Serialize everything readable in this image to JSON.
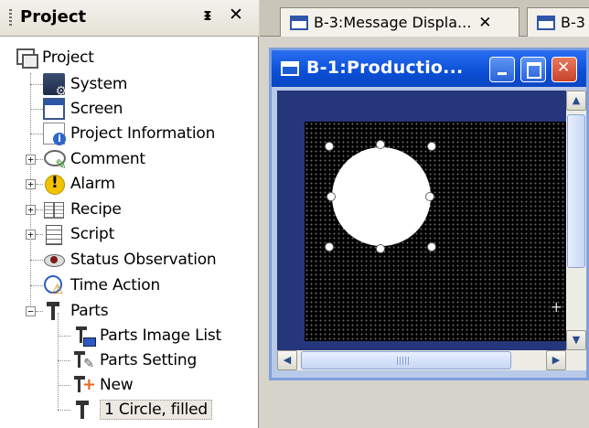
{
  "project_pane": {
    "title": "Project",
    "pin_glyph": "ᵻ",
    "close_glyph": "✕"
  },
  "tree": {
    "root": "Project",
    "items": [
      {
        "label": "System",
        "icon": "system-icon"
      },
      {
        "label": "Screen",
        "icon": "screen-icon"
      },
      {
        "label": "Project Information",
        "icon": "project-info-icon"
      },
      {
        "label": "Comment",
        "icon": "comment-icon",
        "expander": "+"
      },
      {
        "label": "Alarm",
        "icon": "alarm-icon",
        "expander": "+"
      },
      {
        "label": "Recipe",
        "icon": "recipe-icon",
        "expander": "+"
      },
      {
        "label": "Script",
        "icon": "script-icon",
        "expander": "+"
      },
      {
        "label": "Status Observation",
        "icon": "status-observation-icon"
      },
      {
        "label": "Time Action",
        "icon": "time-action-icon"
      },
      {
        "label": "Parts",
        "icon": "parts-icon",
        "expander": "−"
      }
    ],
    "parts_children": [
      {
        "label": "Parts Image List",
        "icon": "parts-image-list-icon"
      },
      {
        "label": "Parts Setting",
        "icon": "parts-setting-icon"
      },
      {
        "label": "New",
        "icon": "new-part-icon"
      },
      {
        "label": "1 Circle, filled",
        "icon": "part-icon",
        "selected": true
      }
    ]
  },
  "tabs": [
    {
      "label": "B-3:Message Displa...",
      "close": "✕"
    },
    {
      "label": "B-3"
    }
  ],
  "doc_window": {
    "title": "B-1:Productio..."
  },
  "colors": {
    "titlebar": "#0b4fd6",
    "canvas_bg": "#000000",
    "shape_fill": "#ffffff",
    "client_bg": "#26367a"
  }
}
